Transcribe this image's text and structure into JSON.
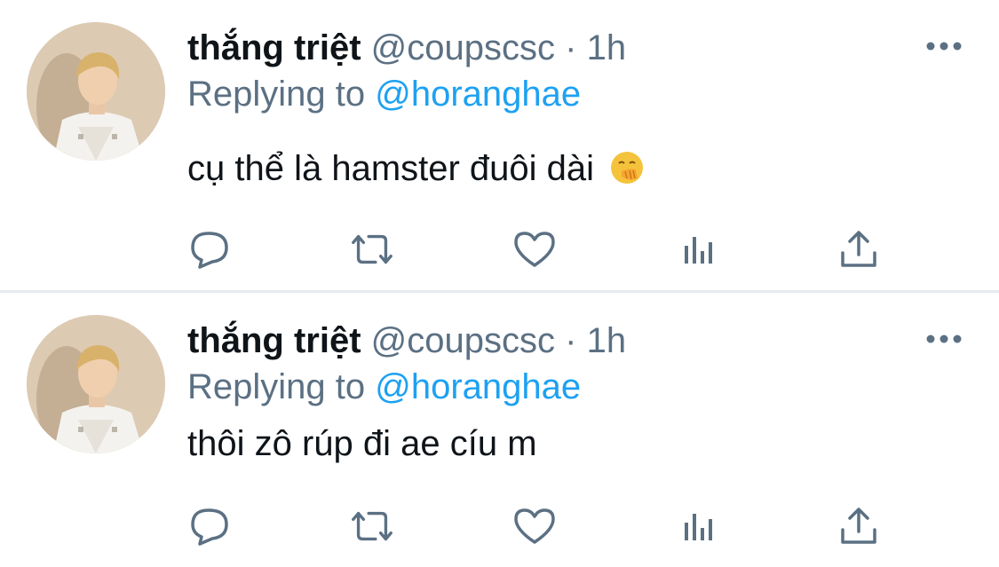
{
  "colors": {
    "text_primary": "#0f1419",
    "text_secondary": "#5b7083",
    "accent": "#1da1f2",
    "divider": "#e6ecf0"
  },
  "tweets": [
    {
      "author_name": "thắng triệt",
      "handle": "@coupscsc",
      "separator": "·",
      "time": "1h",
      "replying_prefix": "Replying to",
      "replying_to": "@horanghae",
      "text": "cụ thể là hamster đuôi dài",
      "emoji": "face-with-hand-over-mouth-icon",
      "icons": [
        "more-icon",
        "reply-icon",
        "retweet-icon",
        "like-icon",
        "analytics-icon",
        "share-icon"
      ]
    },
    {
      "author_name": "thắng triệt",
      "handle": "@coupscsc",
      "separator": "·",
      "time": "1h",
      "replying_prefix": "Replying to",
      "replying_to": "@horanghae",
      "text": "thôi zô rúp đi ae cíu m",
      "icons": [
        "more-icon",
        "reply-icon",
        "retweet-icon",
        "like-icon",
        "analytics-icon",
        "share-icon"
      ]
    }
  ]
}
